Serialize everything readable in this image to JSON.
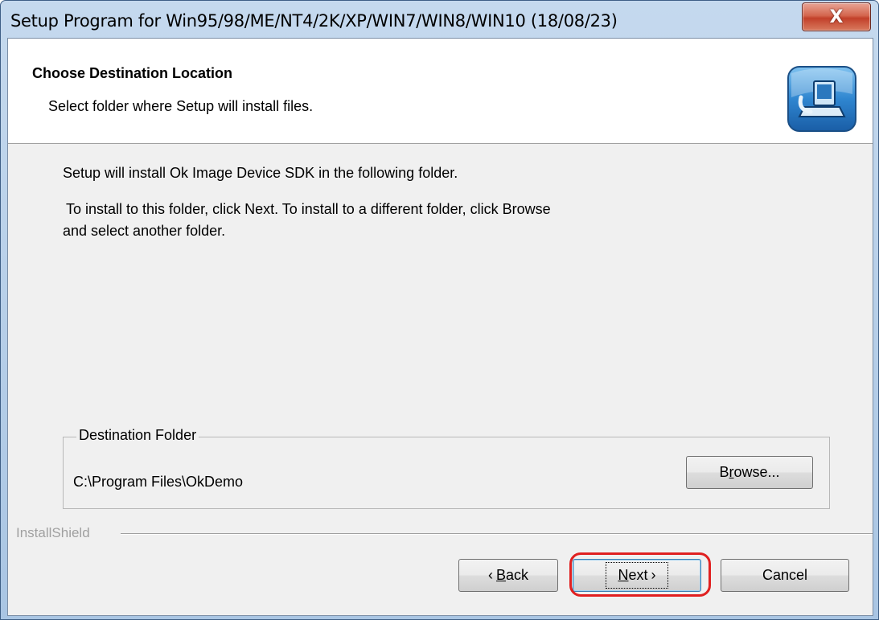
{
  "window": {
    "title": "Setup Program for Win95/98/ME/NT4/2K/XP/WIN7/WIN8/WIN10  (18/08/23)",
    "close_glyph": "X"
  },
  "header": {
    "title": "Choose Destination Location",
    "subtitle": "Select folder where Setup will install files.",
    "icon": "setup-computer-icon"
  },
  "body": {
    "line1": "Setup will install Ok Image Device SDK in the following folder.",
    "line2": "To install to this folder, click Next. To install to a different folder, click Browse",
    "line3": "and select another folder."
  },
  "destination": {
    "legend": "Destination Folder",
    "path": "C:\\Program Files\\OkDemo",
    "browse_prefix": "B",
    "browse_mnemonic": "r",
    "browse_suffix": "owse..."
  },
  "footer": {
    "brand": "InstallShield",
    "back_arrow": "‹",
    "back_mnemonic": "B",
    "back_rest": "ack",
    "next_mnemonic": "N",
    "next_rest": "ext",
    "next_arrow": "›",
    "cancel": "Cancel"
  },
  "annotation": {
    "color": "#e02020",
    "target": "next-button"
  }
}
